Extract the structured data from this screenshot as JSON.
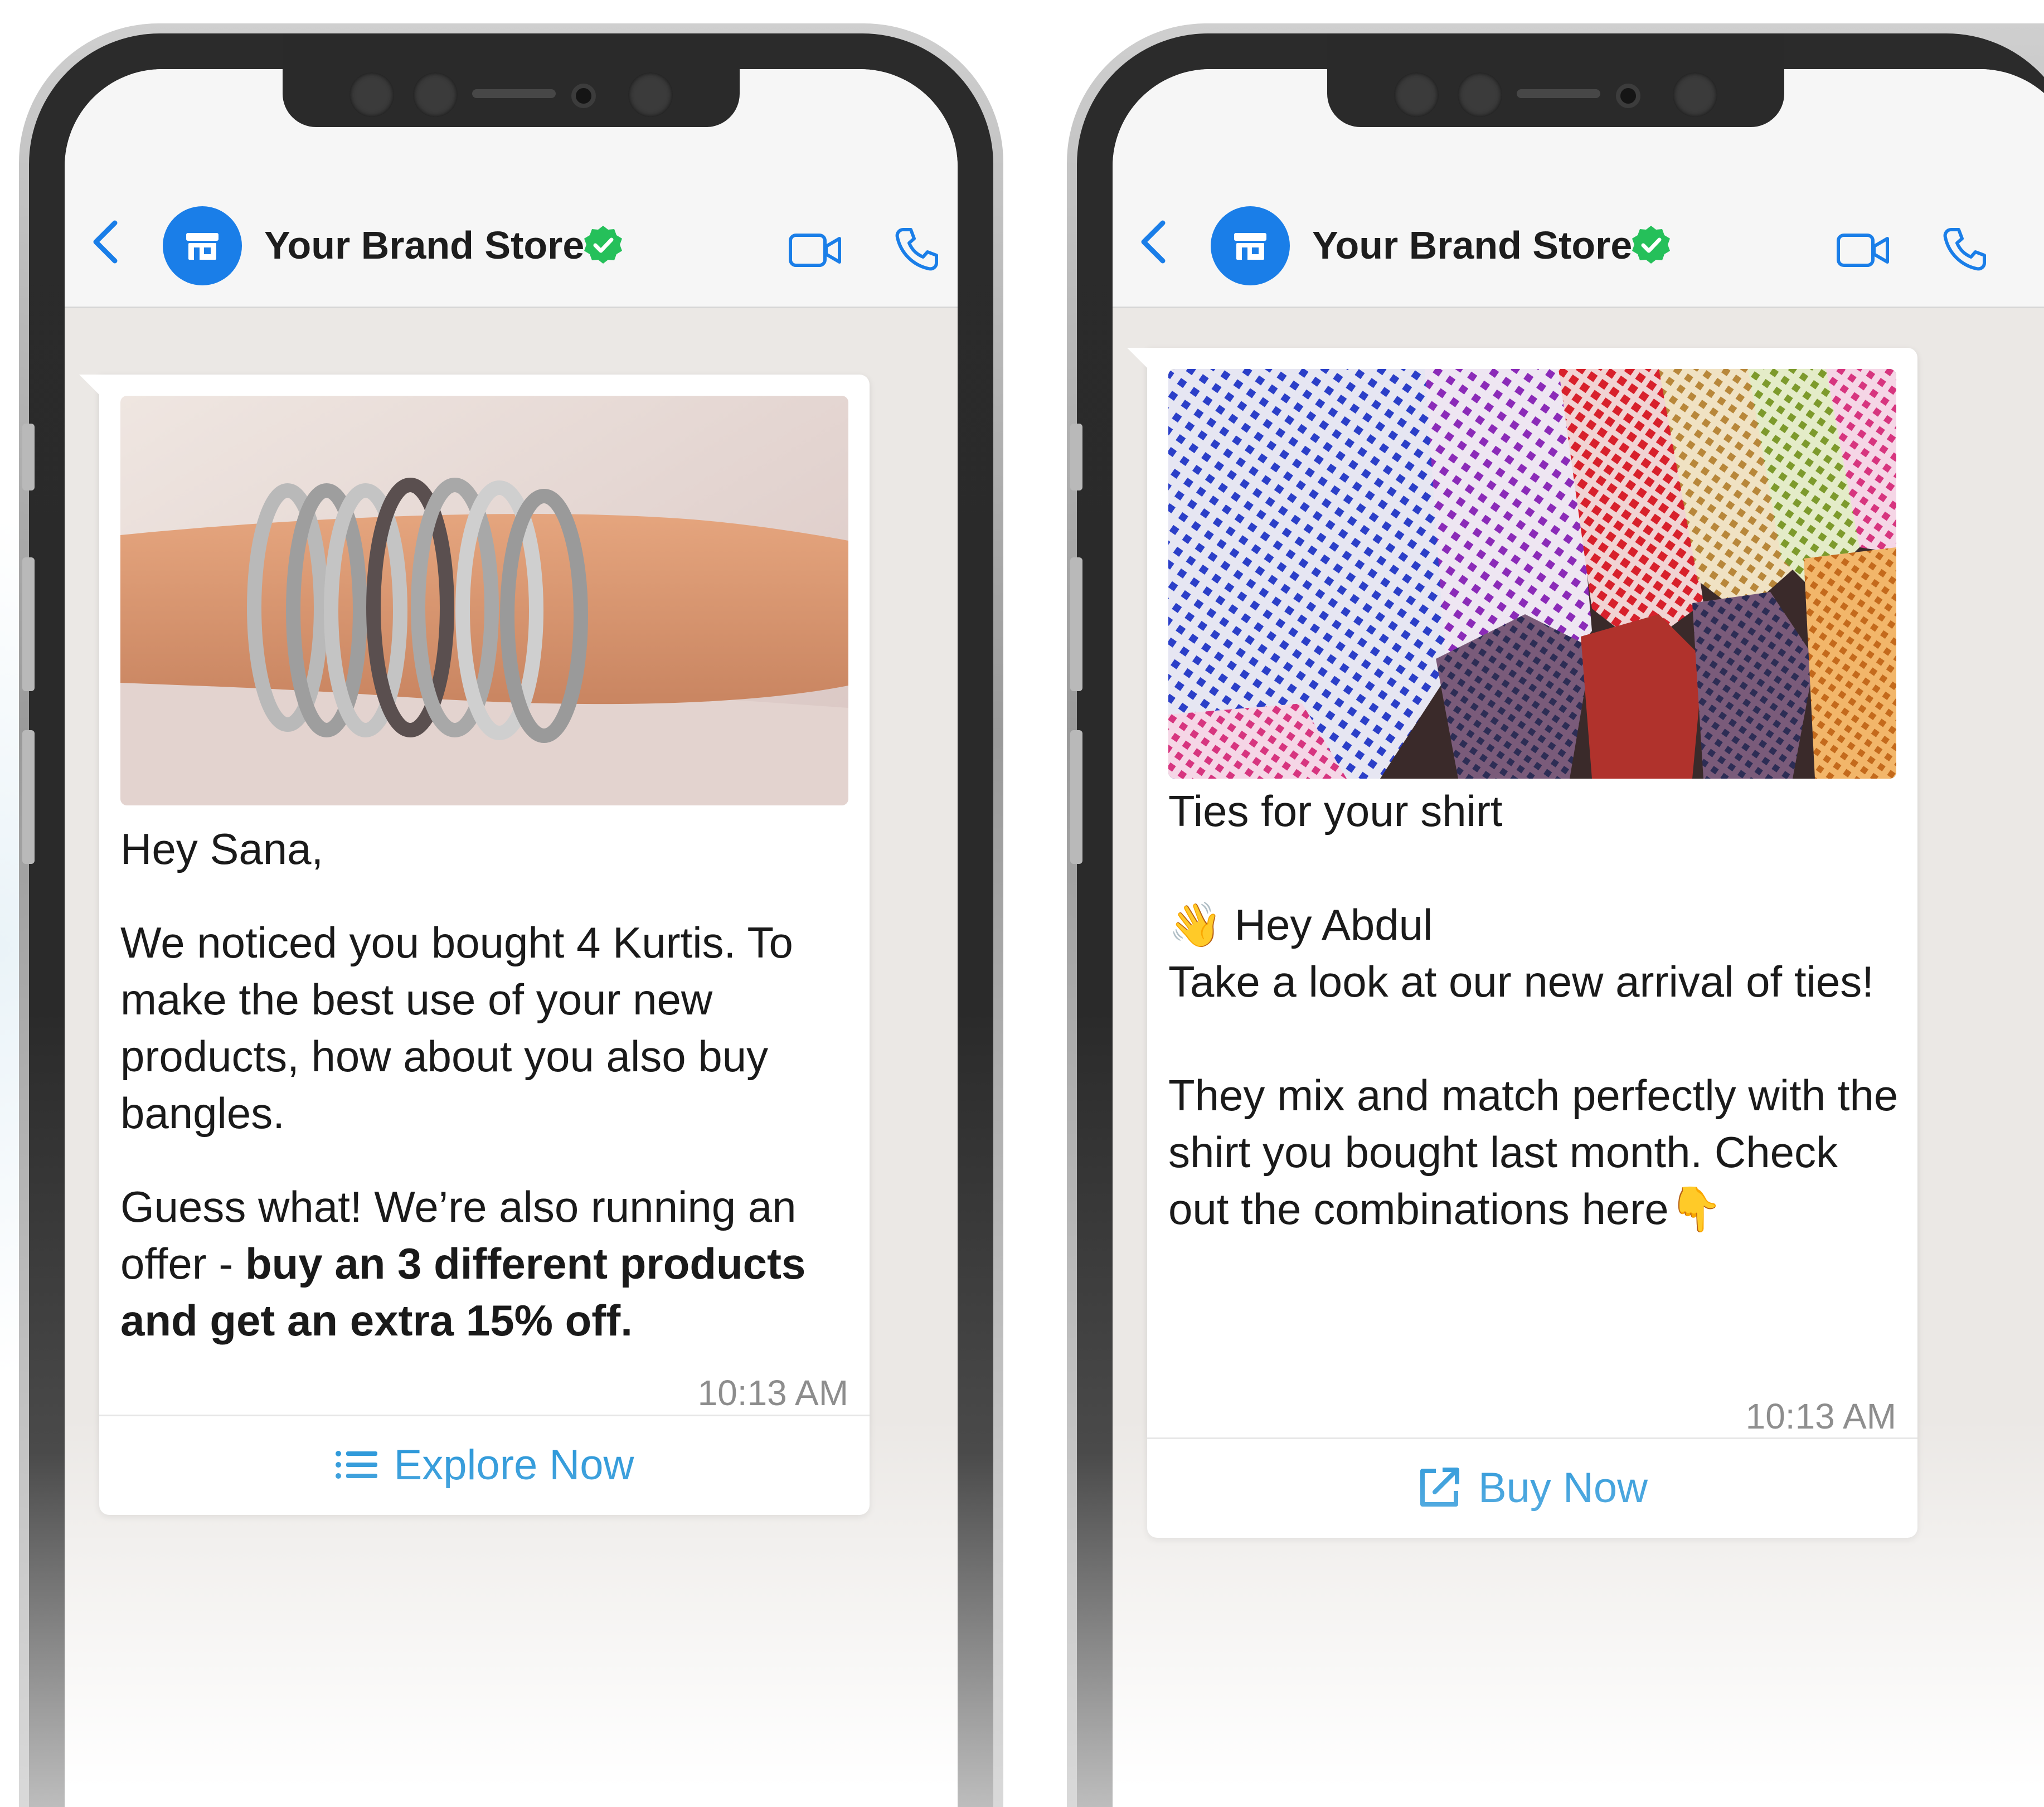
{
  "colors": {
    "brand_blue": "#1a7ee8",
    "verified_green": "#25c05a",
    "cta_blue": "#1a8fd6",
    "chat_bg": "#ebe8e5"
  },
  "left_chat": {
    "header": {
      "title": "Your Brand Store",
      "icons": [
        "chevron-left-icon",
        "store-icon",
        "verified-badge-icon",
        "video-call-icon",
        "voice-call-icon"
      ]
    },
    "message": {
      "image_subject": "silver-bangles-photo",
      "greeting": "Hey Sana,",
      "paragraph_1": "We noticed you bought 4 Kurtis. To make the best use of your new products, how about you also buy bangles.",
      "paragraph_2_plain": "Guess what! We’re also running an offer - ",
      "paragraph_2_bold": "buy an 3 different products and get an extra 15% off.",
      "time": "10:13 AM"
    },
    "cta": {
      "label": "Explore Now",
      "icon": "list-icon"
    }
  },
  "right_chat": {
    "header": {
      "title": "Your Brand Store",
      "icons": [
        "chevron-left-icon",
        "store-icon",
        "verified-badge-icon",
        "video-call-icon",
        "voice-call-icon"
      ]
    },
    "message": {
      "image_subject": "colorful-ties-photo",
      "caption": "Ties for your shirt",
      "greeting_emoji": "👋",
      "greeting": "Hey Abdul",
      "line_1": "Take a look at our new arrival of ties!",
      "line_2": "They mix and match perfectly with the shirt you bought last month. Check out the combinations here",
      "pointing_emoji": "👇",
      "time": "10:13 AM"
    },
    "cta": {
      "label": "Buy Now",
      "icon": "external-link-icon"
    }
  }
}
